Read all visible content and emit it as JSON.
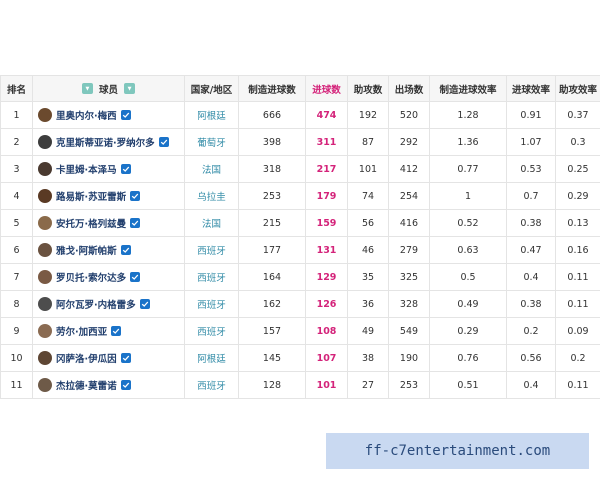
{
  "headers": {
    "rank": "排名",
    "player": "球员",
    "country": "国家/地区",
    "created": "制造进球数",
    "goals": "进球数",
    "assists": "助攻数",
    "apps": "出场数",
    "created_eff": "制造进球效率",
    "goal_eff": "进球效率",
    "assist_eff": "助攻效率"
  },
  "colors": {
    "highlight": "#d4237a",
    "country_text": "#2f8aa6",
    "verified_badge": "#1a73c9",
    "header_bg": "#f6f6f6"
  },
  "rows": [
    {
      "rank": "1",
      "name": "里奥内尔·梅西",
      "country": "阿根廷",
      "created": "666",
      "goals": "474",
      "assists": "192",
      "apps": "520",
      "created_eff": "1.28",
      "goal_eff": "0.91",
      "assist_eff": "0.37",
      "avatar_color": "#6b4a2e"
    },
    {
      "rank": "2",
      "name": "克里斯蒂亚诺·罗纳尔多",
      "country": "葡萄牙",
      "created": "398",
      "goals": "311",
      "assists": "87",
      "apps": "292",
      "created_eff": "1.36",
      "goal_eff": "1.07",
      "assist_eff": "0.3",
      "avatar_color": "#3d3d3d"
    },
    {
      "rank": "3",
      "name": "卡里姆·本泽马",
      "country": "法国",
      "created": "318",
      "goals": "217",
      "assists": "101",
      "apps": "412",
      "created_eff": "0.77",
      "goal_eff": "0.53",
      "assist_eff": "0.25",
      "avatar_color": "#4a3a30"
    },
    {
      "rank": "4",
      "name": "路易斯·苏亚雷斯",
      "country": "乌拉圭",
      "created": "253",
      "goals": "179",
      "assists": "74",
      "apps": "254",
      "created_eff": "1",
      "goal_eff": "0.7",
      "assist_eff": "0.29",
      "avatar_color": "#5a3a24"
    },
    {
      "rank": "5",
      "name": "安托万·格列兹曼",
      "country": "法国",
      "created": "215",
      "goals": "159",
      "assists": "56",
      "apps": "416",
      "created_eff": "0.52",
      "goal_eff": "0.38",
      "assist_eff": "0.13",
      "avatar_color": "#8a6a4a"
    },
    {
      "rank": "6",
      "name": "雅戈·阿斯帕斯",
      "country": "西班牙",
      "created": "177",
      "goals": "131",
      "assists": "46",
      "apps": "279",
      "created_eff": "0.63",
      "goal_eff": "0.47",
      "assist_eff": "0.16",
      "avatar_color": "#6a5240"
    },
    {
      "rank": "7",
      "name": "罗贝托·索尔达多",
      "country": "西班牙",
      "created": "164",
      "goals": "129",
      "assists": "35",
      "apps": "325",
      "created_eff": "0.5",
      "goal_eff": "0.4",
      "assist_eff": "0.11",
      "avatar_color": "#7a5a44"
    },
    {
      "rank": "8",
      "name": "阿尔瓦罗·内格雷多",
      "country": "西班牙",
      "created": "162",
      "goals": "126",
      "assists": "36",
      "apps": "328",
      "created_eff": "0.49",
      "goal_eff": "0.38",
      "assist_eff": "0.11",
      "avatar_color": "#4d4d4d"
    },
    {
      "rank": "9",
      "name": "劳尔·加西亚",
      "country": "西班牙",
      "created": "157",
      "goals": "108",
      "assists": "49",
      "apps": "549",
      "created_eff": "0.29",
      "goal_eff": "0.2",
      "assist_eff": "0.09",
      "avatar_color": "#8a6b52"
    },
    {
      "rank": "10",
      "name": "冈萨洛·伊瓜因",
      "country": "阿根廷",
      "created": "145",
      "goals": "107",
      "assists": "38",
      "apps": "190",
      "created_eff": "0.76",
      "goal_eff": "0.56",
      "assist_eff": "0.2",
      "avatar_color": "#5e4634"
    },
    {
      "rank": "11",
      "name": "杰拉德·莫雷诺",
      "country": "西班牙",
      "created": "128",
      "goals": "101",
      "assists": "27",
      "apps": "253",
      "created_eff": "0.51",
      "goal_eff": "0.4",
      "assist_eff": "0.11",
      "avatar_color": "#6e5a48"
    }
  ],
  "watermark": "ff-c7entertainment.com"
}
